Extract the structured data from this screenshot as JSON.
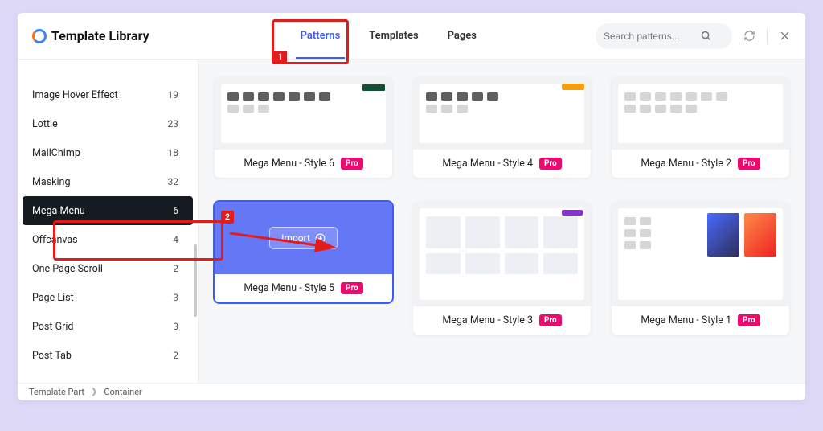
{
  "header": {
    "title": "Template Library",
    "tabs": [
      "Patterns",
      "Templates",
      "Pages"
    ],
    "active_tab": 0,
    "search_placeholder": "Search patterns..."
  },
  "annotations": {
    "badge1": "1",
    "badge2": "2"
  },
  "sidebar": {
    "items": [
      {
        "label": "Image Hover Effect",
        "count": "19"
      },
      {
        "label": "Lottie",
        "count": "23"
      },
      {
        "label": "MailChimp",
        "count": "18"
      },
      {
        "label": "Masking",
        "count": "32"
      },
      {
        "label": "Mega Menu",
        "count": "6",
        "selected": true
      },
      {
        "label": "Offcanvas",
        "count": "4"
      },
      {
        "label": "One Page Scroll",
        "count": "2"
      },
      {
        "label": "Page List",
        "count": "3"
      },
      {
        "label": "Post Grid",
        "count": "3"
      },
      {
        "label": "Post Tab",
        "count": "2"
      }
    ]
  },
  "grid": {
    "import_label": "Import",
    "pro_badge": "Pro",
    "cards": [
      {
        "title": "Mega Menu - Style 6",
        "pro": true
      },
      {
        "title": "Mega Menu - Style 4",
        "pro": true
      },
      {
        "title": "Mega Menu - Style 2",
        "pro": true
      },
      {
        "title": "Mega Menu - Style 5",
        "pro": true,
        "import": true
      },
      {
        "title": "Mega Menu - Style 3",
        "pro": true,
        "tall": true
      },
      {
        "title": "Mega Menu - Style 1",
        "pro": true,
        "tall": true
      }
    ]
  },
  "breadcrumb": {
    "part1": "Template Part",
    "part2": "Container"
  }
}
